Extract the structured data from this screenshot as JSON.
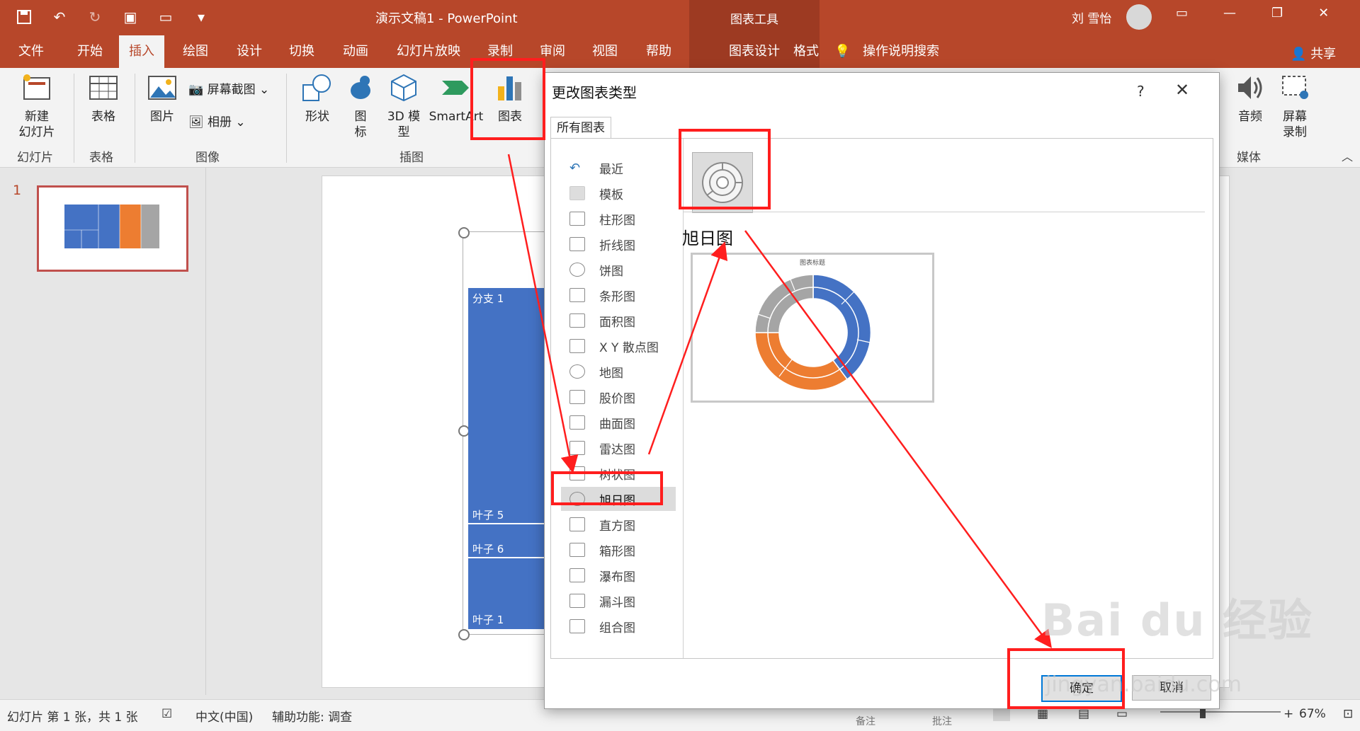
{
  "app": {
    "doc_title": "演示文稿1  -  PowerPoint",
    "context_tools": "图表工具",
    "user_name": "刘 雪怡"
  },
  "tabs": [
    "文件",
    "开始",
    "插入",
    "绘图",
    "设计",
    "切换",
    "动画",
    "幻灯片放映",
    "录制",
    "审阅",
    "视图",
    "帮助",
    "图表设计",
    "格式"
  ],
  "tell_me": "操作说明搜索",
  "share": "共享",
  "ribbon": {
    "new_slide": "新建\n幻灯片",
    "table": "表格",
    "picture": "图片",
    "screenshot": "屏幕截图",
    "album": "相册",
    "shapes": "形状",
    "icons": "图\n标",
    "model3d": "3D 模\n型",
    "smartart": "SmartArt",
    "chart": "图表",
    "audio": "音频",
    "screen_record": "屏幕\n录制",
    "groups": {
      "slides": "幻灯片",
      "tables": "表格",
      "images": "图像",
      "illustrations": "插图",
      "media": "媒体"
    }
  },
  "slide_panel": {
    "number": "1"
  },
  "slide": {
    "labels": [
      "分支 1",
      "叶子 5",
      "叶子 6",
      "叶子 1"
    ]
  },
  "dialog": {
    "title": "更改图表类型",
    "help": "?",
    "close": "✕",
    "tab": "所有图表",
    "categories": [
      "最近",
      "模板",
      "柱形图",
      "折线图",
      "饼图",
      "条形图",
      "面积图",
      "X Y 散点图",
      "地图",
      "股价图",
      "曲面图",
      "雷达图",
      "树状图",
      "旭日图",
      "直方图",
      "箱形图",
      "瀑布图",
      "漏斗图",
      "组合图"
    ],
    "selected_index": 13,
    "type_title": "旭日图",
    "preview_title": "图表标题",
    "ok": "确定",
    "cancel": "取消"
  },
  "status": {
    "slide_info": "幻灯片 第 1 张，共 1 张",
    "language": "中文(中国)",
    "accessibility": "辅助功能: 调查",
    "notes": "备注",
    "comments": "批注",
    "zoom": "67%"
  },
  "watermark": {
    "brand": "Bai du 经验",
    "url": "jingyan.baidu.com"
  },
  "colors": {
    "accent": "#b7472a",
    "blue": "#4472c4",
    "orange": "#ed7d31",
    "gray": "#a5a5a5",
    "annotation": "#ff1e1e"
  }
}
